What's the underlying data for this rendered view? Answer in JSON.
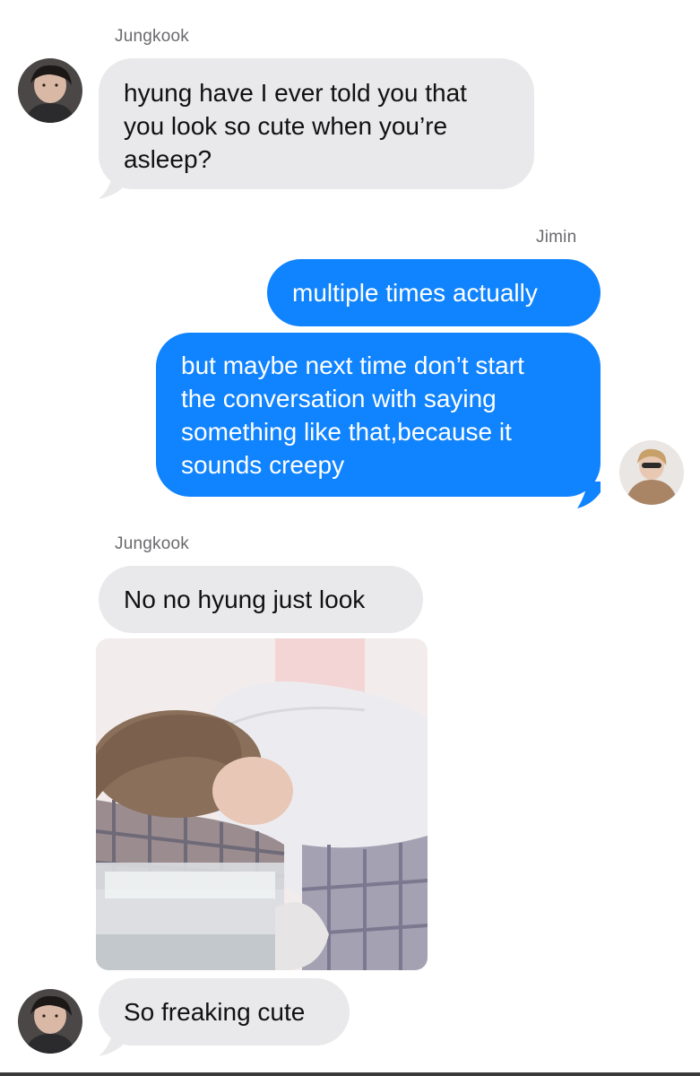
{
  "conversation": {
    "messages": [
      {
        "sender": "Jungkook",
        "direction": "incoming",
        "text": "hyung have I ever told you that\nyou look so cute when you’re\nasleep?"
      },
      {
        "sender": "Jimin",
        "direction": "outgoing",
        "text": "multiple times actually"
      },
      {
        "sender": "Jimin",
        "direction": "outgoing",
        "text": "but maybe next time don’t start\nthe conversation with saying\nsomething like that,because it\nsounds creepy"
      },
      {
        "sender": "Jungkook",
        "direction": "incoming",
        "text": "No no hyung just look"
      },
      {
        "sender": "Jungkook",
        "direction": "incoming",
        "type": "photo"
      },
      {
        "sender": "Jungkook",
        "direction": "incoming",
        "text": "So freaking cute"
      }
    ],
    "sender_labels": {
      "jungkook_first": "Jungkook",
      "jimin": "Jimin",
      "jungkook_second": "Jungkook"
    }
  },
  "colors": {
    "incoming_bubble": "#e9e9eb",
    "outgoing_bubble": "#1083fe",
    "sender_label": "#6b6b6f"
  }
}
